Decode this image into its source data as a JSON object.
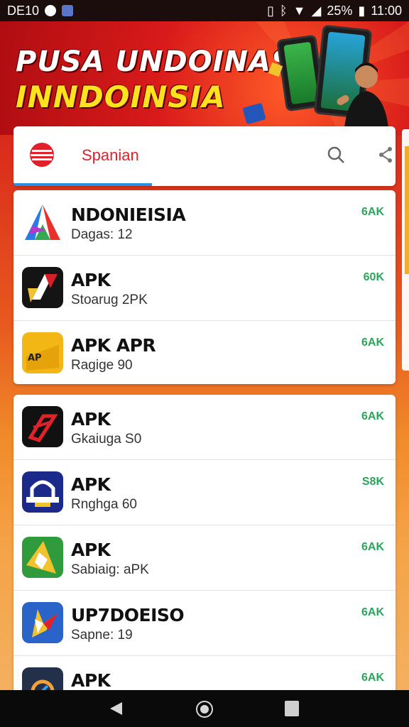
{
  "status_bar": {
    "carrier": "DE10",
    "battery_percent": "25%",
    "time": "11:00"
  },
  "banner": {
    "title_line1": "PUSA UNDOINAS",
    "title_line2": "INNDOINSIA"
  },
  "search": {
    "text": "Spanian",
    "accent_color": "#e0202a",
    "tab_indicator_color": "#2a8fe0"
  },
  "apps_group1": [
    {
      "title": "NDONIEISIA",
      "subtitle": "Dagas: 12",
      "size": "6AK",
      "icon": "triangle-logo-icon"
    },
    {
      "title": "APK",
      "subtitle": "Stoarug 2PK",
      "size": "60K",
      "icon": "sword-logo-icon"
    },
    {
      "title": "APK APR",
      "subtitle": "Ragige 90",
      "size": "6AK",
      "icon": "yellow-ticket-icon"
    }
  ],
  "apps_group2": [
    {
      "title": "APK",
      "subtitle": "Gkaiuga S0",
      "size": "6AK",
      "icon": "red-arrow-logo-icon"
    },
    {
      "title": "APK",
      "subtitle": "Rnghga 60",
      "size": "S8K",
      "icon": "blue-arch-logo-icon"
    },
    {
      "title": "APK",
      "subtitle": "Sabiaig: aPK",
      "size": "6AK",
      "icon": "green-star-logo-icon"
    },
    {
      "title": "UP7DOEISO",
      "subtitle": "Sapne: 19",
      "size": "6AK",
      "icon": "blue-star-logo-icon"
    },
    {
      "title": "APK",
      "subtitle": "",
      "size": "6AK",
      "icon": "dark-gear-logo-icon"
    }
  ],
  "size_color": "#2aa55a"
}
